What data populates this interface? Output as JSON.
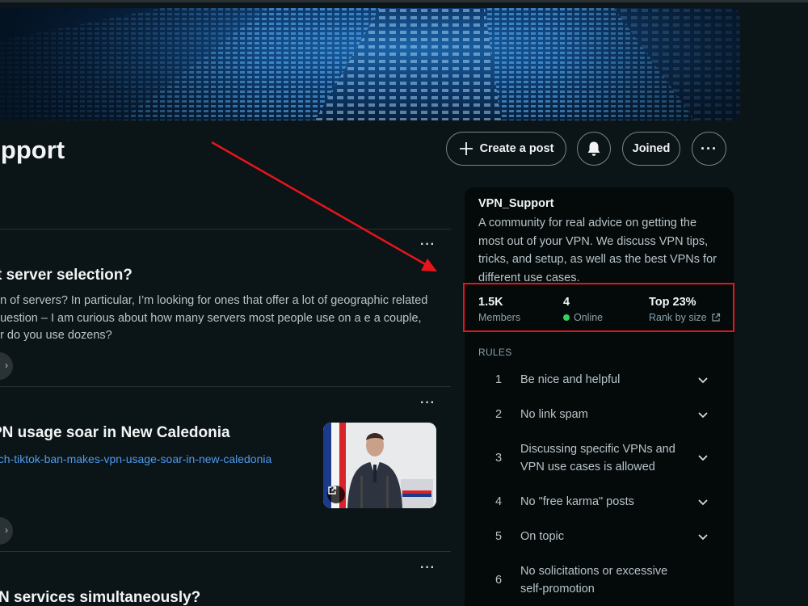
{
  "community": {
    "title": "upport"
  },
  "actions": {
    "create_post_label": "Create a post",
    "joined_label": "Joined",
    "more_label": "···"
  },
  "posts": [
    {
      "more_label": "···",
      "title": "t server selection?",
      "body": "on of servers? In particular, I’m looking for ones that offer a lot of geographic related question – I am curious about how many servers most people use on a e a couple, or do you use dozens?"
    },
    {
      "more_label": "···",
      "title": "PN usage soar in New Caledonia",
      "link": "nch-tiktok-ban-makes-vpn-usage-soar-in-new-caledonia"
    },
    {
      "more_label": "···",
      "title": "N services simultaneously?"
    }
  ],
  "sidebar": {
    "name": "VPN_Support",
    "description": "A community for real advice on getting the most out of your VPN. We discuss VPN tips, tricks, and setup, as well as the best VPNs for different use cases.",
    "stats": [
      {
        "value": "1.5K",
        "label": "Members"
      },
      {
        "value": "4",
        "label": "Online"
      },
      {
        "value": "Top 23%",
        "label": "Rank by size"
      }
    ],
    "rules_header": "RULES",
    "rules": [
      {
        "num": "1",
        "text": "Be nice and helpful"
      },
      {
        "num": "2",
        "text": "No link spam"
      },
      {
        "num": "3",
        "text": "Discussing specific VPNs and VPN use cases is allowed"
      },
      {
        "num": "4",
        "text": "No \"free karma\" posts"
      },
      {
        "num": "5",
        "text": "On topic"
      },
      {
        "num": "6",
        "text": "No solicitations or excessive self-promotion"
      }
    ]
  },
  "colors": {
    "background": "#0b1416",
    "sidebar_bg": "#04090a",
    "link": "#4f9bf0",
    "annotation_red": "#e8141b",
    "online_green": "#2fd35b"
  }
}
